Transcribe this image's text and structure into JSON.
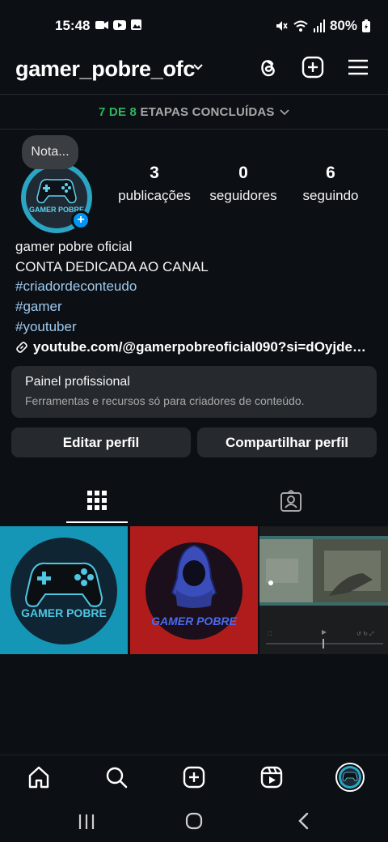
{
  "status_bar": {
    "time": "15:48",
    "battery": "80%",
    "left_icons": [
      "video-call-icon",
      "youtube-icon",
      "gallery-icon"
    ],
    "right_icons": [
      "mute-icon",
      "wifi-icon",
      "signal-icon",
      "battery-icon"
    ]
  },
  "header": {
    "username": "gamer_pobre_ofc",
    "icons": [
      "chevron-down-icon",
      "threads-icon",
      "create-post-icon",
      "menu-icon"
    ]
  },
  "steps": {
    "progress": "7 DE 8",
    "label": "ETAPAS CONCLUÍDAS"
  },
  "profile": {
    "note": "Nota...",
    "avatar_text": "GAMER POBRE",
    "stats": [
      {
        "value": "3",
        "label": "publicações"
      },
      {
        "value": "0",
        "label": "seguidores"
      },
      {
        "value": "6",
        "label": "seguindo"
      }
    ],
    "name": "gamer pobre oficial",
    "bio_line": "CONTA DEDICADA AO CANAL",
    "hashtags": [
      "#criadordeconteudo",
      "#gamer",
      "#youtuber"
    ],
    "link": "youtube.com/@gamerpobreoficial090?si=dOyjde…"
  },
  "panel": {
    "title": "Painel profissional",
    "subtitle": "Ferramentas e recursos só para criadores de conteúdo."
  },
  "buttons": {
    "edit": "Editar perfil",
    "share": "Compartilhar perfil"
  },
  "posts": [
    {
      "text": "GAMER POBRE",
      "bg": "#1596b6"
    },
    {
      "text": "GAMER POBRE",
      "bg": "#b01c1c"
    },
    {
      "text": "",
      "bg": "#1b1d1f"
    }
  ],
  "colors": {
    "background": "#0c1014",
    "surface": "#262a2e",
    "accent": "#0095f6",
    "green": "#2fb660",
    "hashtag": "#9fc9ee"
  }
}
